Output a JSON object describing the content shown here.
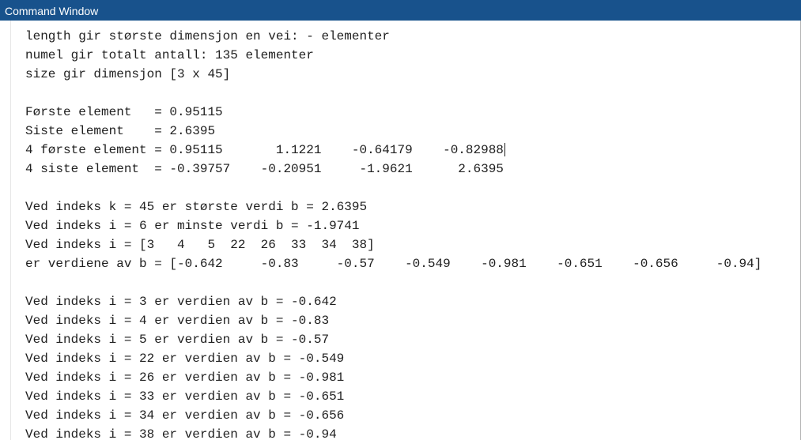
{
  "window": {
    "title": "Command Window"
  },
  "output_lines": [
    "length gir største dimensjon en vei: - elementer",
    "numel gir totalt antall: 135 elementer",
    "size gir dimensjon [3 x 45]",
    "",
    "Første element   = 0.95115",
    "Siste element    = 2.6395",
    "4 første element = 0.95115       1.1221    -0.64179    -0.82988",
    "4 siste element  = -0.39757    -0.20951     -1.9621      2.6395",
    "",
    "Ved indeks k = 45 er største verdi b = 2.6395",
    "Ved indeks i = 6 er minste verdi b = -1.9741",
    "Ved indeks i = [3   4   5  22  26  33  34  38]",
    "er verdiene av b = [-0.642     -0.83     -0.57    -0.549    -0.981    -0.651    -0.656     -0.94]",
    "",
    "Ved indeks i = 3 er verdien av b = -0.642",
    "Ved indeks i = 4 er verdien av b = -0.83",
    "Ved indeks i = 5 er verdien av b = -0.57",
    "Ved indeks i = 22 er verdien av b = -0.549",
    "Ved indeks i = 26 er verdien av b = -0.981",
    "Ved indeks i = 33 er verdien av b = -0.651",
    "Ved indeks i = 34 er verdien av b = -0.656",
    "Ved indeks i = 38 er verdien av b = -0.94"
  ],
  "colors": {
    "title_bar": "#18528c",
    "title_text": "#ffffff",
    "console_text": "#202020",
    "background": "#ffffff"
  }
}
